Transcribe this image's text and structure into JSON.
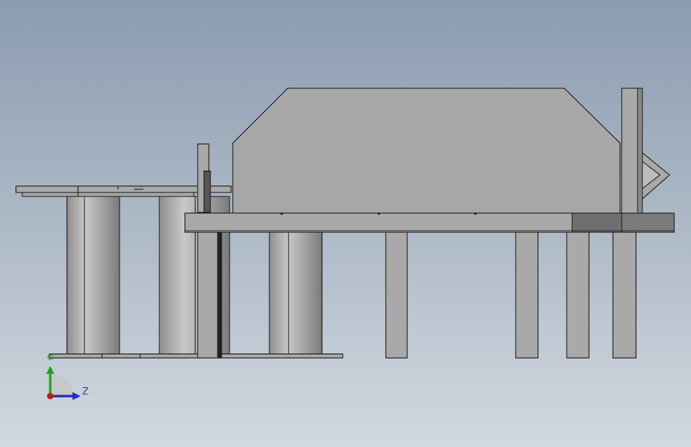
{
  "viewport": {
    "background_top": "#8b9cb0",
    "background_bottom": "#d2d8e0"
  },
  "model": {
    "body_color": "#a7a7a7",
    "edge_color": "#1a1a1a",
    "dark_part_color": "#6f6f6f"
  },
  "triad": {
    "z_label": "Z",
    "y_color": "#1fa31f",
    "z_color": "#1f2fbf",
    "x_color": "#c41a1a"
  }
}
